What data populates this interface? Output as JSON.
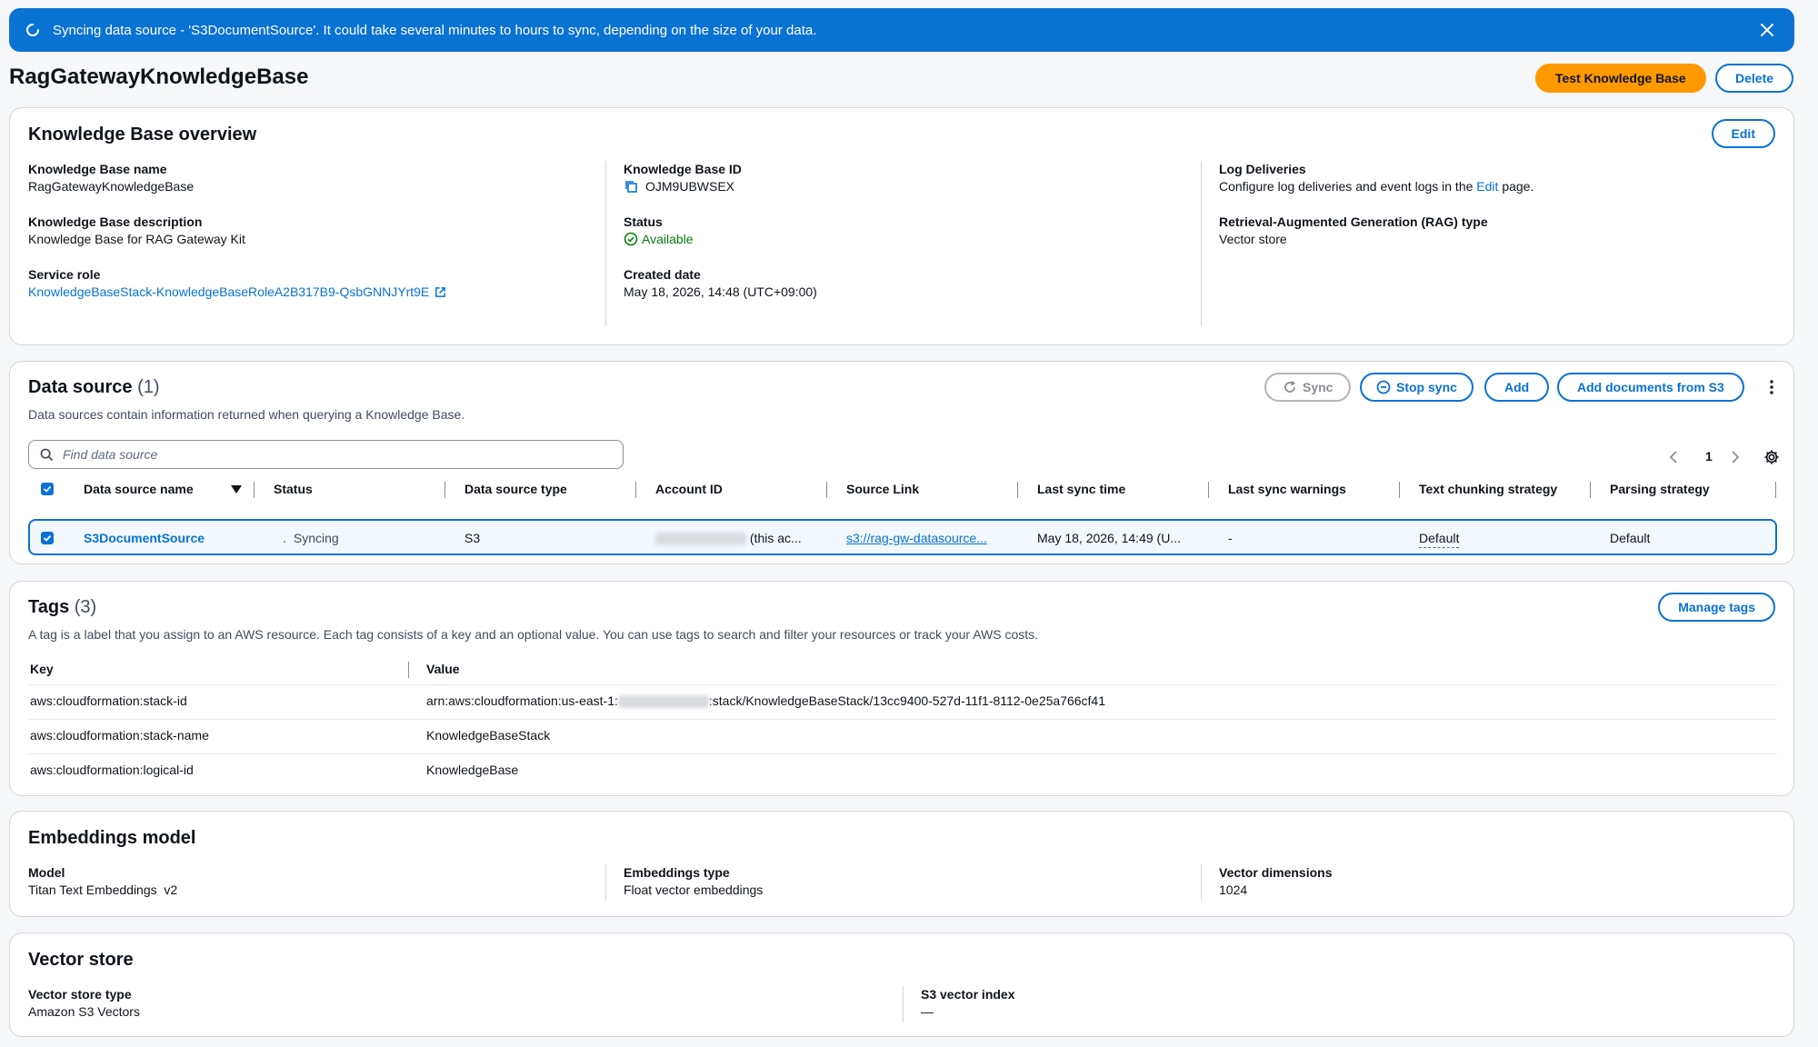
{
  "banner": {
    "message": "Syncing data source - 'S3DocumentSource'. It could take several minutes to hours to sync, depending on the size of your data.",
    "icon": "spinner-icon",
    "close_icon": "close-icon"
  },
  "page": {
    "title": "RagGatewayKnowledgeBase",
    "test_button": "Test Knowledge Base",
    "delete_button": "Delete"
  },
  "overview": {
    "title": "Knowledge Base overview",
    "edit_button": "Edit",
    "name_label": "Knowledge Base name",
    "name_value": "RagGatewayKnowledgeBase",
    "description_label": "Knowledge Base description",
    "description_value": "Knowledge Base for RAG Gateway Kit",
    "role_label": "Service role",
    "role_value": "KnowledgeBaseStack-KnowledgeBaseRoleA2B317B9-QsbGNNJYrt9E",
    "id_label": "Knowledge Base ID",
    "id_value": "OJM9UBWSEX",
    "status_label": "Status",
    "status_value": "Available",
    "created_label": "Created date",
    "created_value": "May 18, 2026, 14:48 (UTC+09:00)",
    "log_label": "Log Deliveries",
    "log_prefix": "Configure log deliveries and event logs in the",
    "log_link": "Edit",
    "log_suffix": "page.",
    "rag_label": "Retrieval-Augmented Generation (RAG) type",
    "rag_value": "Vector store"
  },
  "data_source": {
    "title": "Data source",
    "count": "(1)",
    "description": "Data sources contain information returned when querying a Knowledge Base.",
    "sync_button": "Sync",
    "stop_sync_button": "Stop sync",
    "add_button": "Add",
    "add_docs_button": "Add documents from S3",
    "search_placeholder": "Find data source",
    "page_number": "1",
    "columns": [
      "Data source name",
      "Status",
      "Data source type",
      "Account ID",
      "Source Link",
      "Last sync time",
      "Last sync warnings",
      "Text chunking strategy",
      "Parsing strategy"
    ],
    "row": {
      "name": "S3DocumentSource",
      "status": "Syncing",
      "type": "S3",
      "account_suffix": "(this ac...",
      "source_link": "s3://rag-gw-datasource...",
      "last_sync": "May 18, 2026, 14:49 (U...",
      "warnings": "-",
      "chunking": "Default",
      "parsing": "Default"
    }
  },
  "tags": {
    "title": "Tags",
    "count": "(3)",
    "description": "A tag is a label that you assign to an AWS resource. Each tag consists of a key and an optional value. You can use tags to search and filter your resources or track your AWS costs.",
    "manage_button": "Manage tags",
    "key_header": "Key",
    "value_header": "Value",
    "rows": [
      {
        "key": "aws:cloudformation:stack-id",
        "value_prefix": "arn:aws:cloudformation:us-east-1:",
        "value_suffix": ":stack/KnowledgeBaseStack/13cc9400-527d-11f1-8112-0e25a766cf41"
      },
      {
        "key": "aws:cloudformation:stack-name",
        "value": "KnowledgeBaseStack"
      },
      {
        "key": "aws:cloudformation:logical-id",
        "value": "KnowledgeBase"
      }
    ]
  },
  "embeddings": {
    "title": "Embeddings model",
    "model_label": "Model",
    "model_value": "Titan Text Embeddings  v2",
    "type_label": "Embeddings type",
    "type_value": "Float vector embeddings",
    "dims_label": "Vector dimensions",
    "dims_value": "1024"
  },
  "vector_store": {
    "title": "Vector store",
    "type_label": "Vector store type",
    "type_value": "Amazon S3 Vectors",
    "index_label": "S3 vector index",
    "index_value": "—"
  },
  "colors": {
    "accent": "#0972d3",
    "primary_button": "#ff9900",
    "success": "#037f0c"
  }
}
